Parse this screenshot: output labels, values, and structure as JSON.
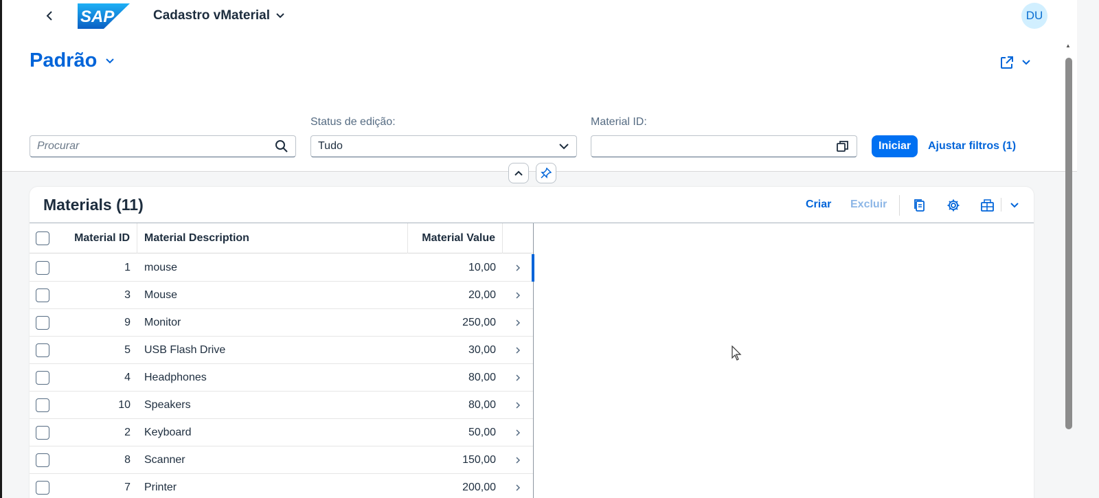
{
  "shell": {
    "app_title": "Cadastro vMaterial",
    "avatar_initials": "DU",
    "logo_text": "SAP"
  },
  "header": {
    "variant_name": "Padrão",
    "search": {
      "placeholder": "Procurar",
      "value": ""
    },
    "status_filter": {
      "label": "Status de edição:",
      "value": "Tudo"
    },
    "material_filter": {
      "label": "Material ID:",
      "value": ""
    },
    "go_label": "Iniciar",
    "adapt_filters_label": "Ajustar filtros (1)"
  },
  "table": {
    "title": "Materials (11)",
    "actions": {
      "create": "Criar",
      "delete": "Excluir"
    },
    "columns": [
      "Material ID",
      "Material Description",
      "Material Value"
    ],
    "rows": [
      {
        "id": "1",
        "desc": "mouse",
        "value": "10,00"
      },
      {
        "id": "3",
        "desc": "Mouse",
        "value": "20,00"
      },
      {
        "id": "9",
        "desc": "Monitor",
        "value": "250,00"
      },
      {
        "id": "5",
        "desc": "USB Flash Drive",
        "value": "30,00"
      },
      {
        "id": "4",
        "desc": "Headphones",
        "value": "80,00"
      },
      {
        "id": "10",
        "desc": "Speakers",
        "value": "80,00"
      },
      {
        "id": "2",
        "desc": "Keyboard",
        "value": "50,00"
      },
      {
        "id": "8",
        "desc": "Scanner",
        "value": "150,00"
      },
      {
        "id": "7",
        "desc": "Printer",
        "value": "200,00"
      }
    ]
  },
  "colors": {
    "accent": "#0064d9",
    "button": "#0070f2",
    "disabled_action": "#8cb6e6"
  }
}
